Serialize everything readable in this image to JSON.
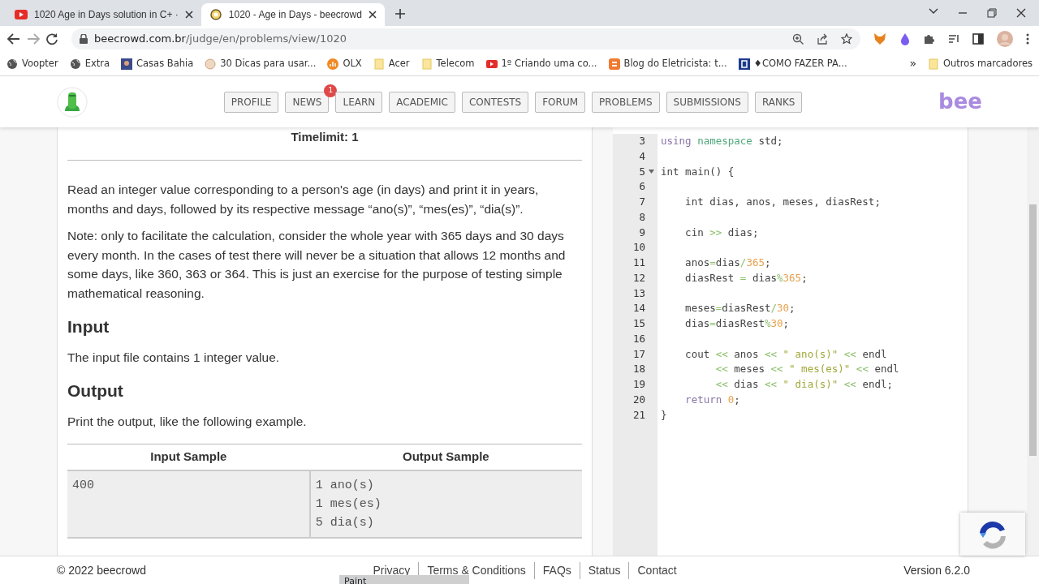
{
  "browser": {
    "tabs": [
      {
        "title": "1020 Age in Days solution in C+ ·",
        "kind": "video",
        "selected": false
      },
      {
        "title": "1020 - Age in Days - beecrowd",
        "kind": "site",
        "selected": true
      }
    ],
    "address": {
      "host": "beecrowd.com.br",
      "path": "/judge/en/problems/view/1020"
    },
    "bookmarks": [
      {
        "label": "Voopter",
        "kind": "globe"
      },
      {
        "label": "Extra",
        "kind": "globe"
      },
      {
        "label": "Casas Bahia",
        "kind": "photo"
      },
      {
        "label": "30 Dicas para usar...",
        "kind": "round"
      },
      {
        "label": "OLX",
        "kind": "chart"
      },
      {
        "label": "Acer",
        "kind": "folder"
      },
      {
        "label": "Telecom",
        "kind": "folder"
      },
      {
        "label": "1º Criando uma co...",
        "kind": "video"
      },
      {
        "label": "Blog do Eletricista: t...",
        "kind": "blog"
      },
      {
        "label": "♦COMO FAZER PA...",
        "kind": "letter"
      }
    ],
    "overflow": "»",
    "other_bookmarks": "Outros marcadores"
  },
  "site": {
    "nav": [
      {
        "label": "PROFILE"
      },
      {
        "label": "NEWS",
        "badge": "1"
      },
      {
        "label": "LEARN"
      },
      {
        "label": "ACADEMIC"
      },
      {
        "label": "CONTESTS"
      },
      {
        "label": "FORUM"
      },
      {
        "label": "PROBLEMS"
      },
      {
        "label": "SUBMISSIONS"
      },
      {
        "label": "RANKS"
      }
    ],
    "brand": "bee"
  },
  "problem": {
    "timelimit": "Timelimit: 1",
    "paragraphs": [
      "Read an integer value corresponding to a person's age (in days) and print it in years, months and days, followed by its respective message “ano(s)”, “mes(es)”, “dia(s)”.",
      "Note: only to facilitate the calculation, consider the whole year with 365 days and 30 days every month. In the cases of test there will never be a situation that allows 12 months and some days, like 360, 363 or 364. This is just an exercise for the purpose of testing simple mathematical reasoning."
    ],
    "sections": [
      {
        "heading": "Input",
        "text": "The input file contains 1 integer value."
      },
      {
        "heading": "Output",
        "text": "Print the output, like the following example."
      }
    ],
    "samples": {
      "columns": [
        "Input Sample",
        "Output Sample"
      ],
      "input_lines": [
        "400"
      ],
      "output_lines": [
        "1 ano(s)",
        "1 mes(es)",
        "5 dia(s)"
      ]
    }
  },
  "editor": {
    "lines": [
      {
        "number": "3",
        "foldable": false,
        "tokens": [
          {
            "text": "using",
            "kind": "keyword"
          },
          {
            "text": " namespace",
            "kind": "namespace"
          },
          {
            "text": " std;",
            "kind": "plain"
          }
        ]
      },
      {
        "number": "4",
        "foldable": false
      },
      {
        "number": "5",
        "foldable": true,
        "tokens": [
          {
            "text": "int main() {",
            "kind": "plain"
          }
        ]
      },
      {
        "number": "6",
        "foldable": false
      },
      {
        "number": "7",
        "foldable": false,
        "tokens": [
          {
            "text": "    int dias, anos, meses, diasRest;",
            "kind": "plain"
          }
        ]
      },
      {
        "number": "8",
        "foldable": false
      },
      {
        "number": "9",
        "foldable": false,
        "tokens": [
          {
            "text": "    cin ",
            "kind": "plain"
          },
          {
            "text": ">>",
            "kind": "operator"
          },
          {
            "text": " dias;",
            "kind": "plain"
          }
        ]
      },
      {
        "number": "10",
        "foldable": false
      },
      {
        "number": "11",
        "foldable": false,
        "tokens": [
          {
            "text": "    anos",
            "kind": "plain"
          },
          {
            "text": "=",
            "kind": "operator"
          },
          {
            "text": "dias",
            "kind": "plain"
          },
          {
            "text": "/",
            "kind": "operator"
          },
          {
            "text": "365",
            "kind": "number"
          },
          {
            "text": ";",
            "kind": "plain"
          }
        ]
      },
      {
        "number": "12",
        "foldable": false,
        "tokens": [
          {
            "text": "    diasRest ",
            "kind": "plain"
          },
          {
            "text": "=",
            "kind": "operator"
          },
          {
            "text": " dias",
            "kind": "plain"
          },
          {
            "text": "%",
            "kind": "operator"
          },
          {
            "text": "365",
            "kind": "number"
          },
          {
            "text": ";",
            "kind": "plain"
          }
        ]
      },
      {
        "number": "13",
        "foldable": false
      },
      {
        "number": "14",
        "foldable": false,
        "tokens": [
          {
            "text": "    meses",
            "kind": "plain"
          },
          {
            "text": "=",
            "kind": "operator"
          },
          {
            "text": "diasRest",
            "kind": "plain"
          },
          {
            "text": "/",
            "kind": "operator"
          },
          {
            "text": "30",
            "kind": "number"
          },
          {
            "text": ";",
            "kind": "plain"
          }
        ]
      },
      {
        "number": "15",
        "foldable": false,
        "tokens": [
          {
            "text": "    dias",
            "kind": "plain"
          },
          {
            "text": "=",
            "kind": "operator"
          },
          {
            "text": "diasRest",
            "kind": "plain"
          },
          {
            "text": "%",
            "kind": "operator"
          },
          {
            "text": "30",
            "kind": "number"
          },
          {
            "text": ";",
            "kind": "plain"
          }
        ]
      },
      {
        "number": "16",
        "foldable": false
      },
      {
        "number": "17",
        "foldable": false,
        "tokens": [
          {
            "text": "    cout ",
            "kind": "plain"
          },
          {
            "text": "<<",
            "kind": "operator"
          },
          {
            "text": " anos ",
            "kind": "plain"
          },
          {
            "text": "<<",
            "kind": "operator"
          },
          {
            "text": " \" ano(s)\" ",
            "kind": "string"
          },
          {
            "text": "<<",
            "kind": "operator"
          },
          {
            "text": " endl",
            "kind": "plain"
          }
        ]
      },
      {
        "number": "18",
        "foldable": false,
        "tokens": [
          {
            "text": "         <<",
            "kind": "operator"
          },
          {
            "text": " meses ",
            "kind": "plain"
          },
          {
            "text": "<<",
            "kind": "operator"
          },
          {
            "text": " \" mes(es)\" ",
            "kind": "string"
          },
          {
            "text": "<<",
            "kind": "operator"
          },
          {
            "text": " endl",
            "kind": "plain"
          }
        ]
      },
      {
        "number": "19",
        "foldable": false,
        "tokens": [
          {
            "text": "         <<",
            "kind": "operator"
          },
          {
            "text": " dias ",
            "kind": "plain"
          },
          {
            "text": "<<",
            "kind": "operator"
          },
          {
            "text": " \" dia(s)\" ",
            "kind": "string"
          },
          {
            "text": "<<",
            "kind": "operator"
          },
          {
            "text": " endl;",
            "kind": "plain"
          }
        ]
      },
      {
        "number": "20",
        "foldable": false,
        "tokens": [
          {
            "text": "    return",
            "kind": "keyword"
          },
          {
            "text": " 0",
            "kind": "number"
          },
          {
            "text": ";",
            "kind": "plain"
          }
        ]
      },
      {
        "number": "21",
        "foldable": false,
        "tokens": [
          {
            "text": "}",
            "kind": "plain"
          }
        ]
      }
    ]
  },
  "footer": {
    "copyright": "© 2022 beecrowd",
    "links": [
      "Privacy",
      "Terms & Conditions",
      "FAQs",
      "Status",
      "Contact"
    ],
    "version": "Version 6.2.0"
  },
  "taskbar_preview": {
    "title": "Paint"
  }
}
